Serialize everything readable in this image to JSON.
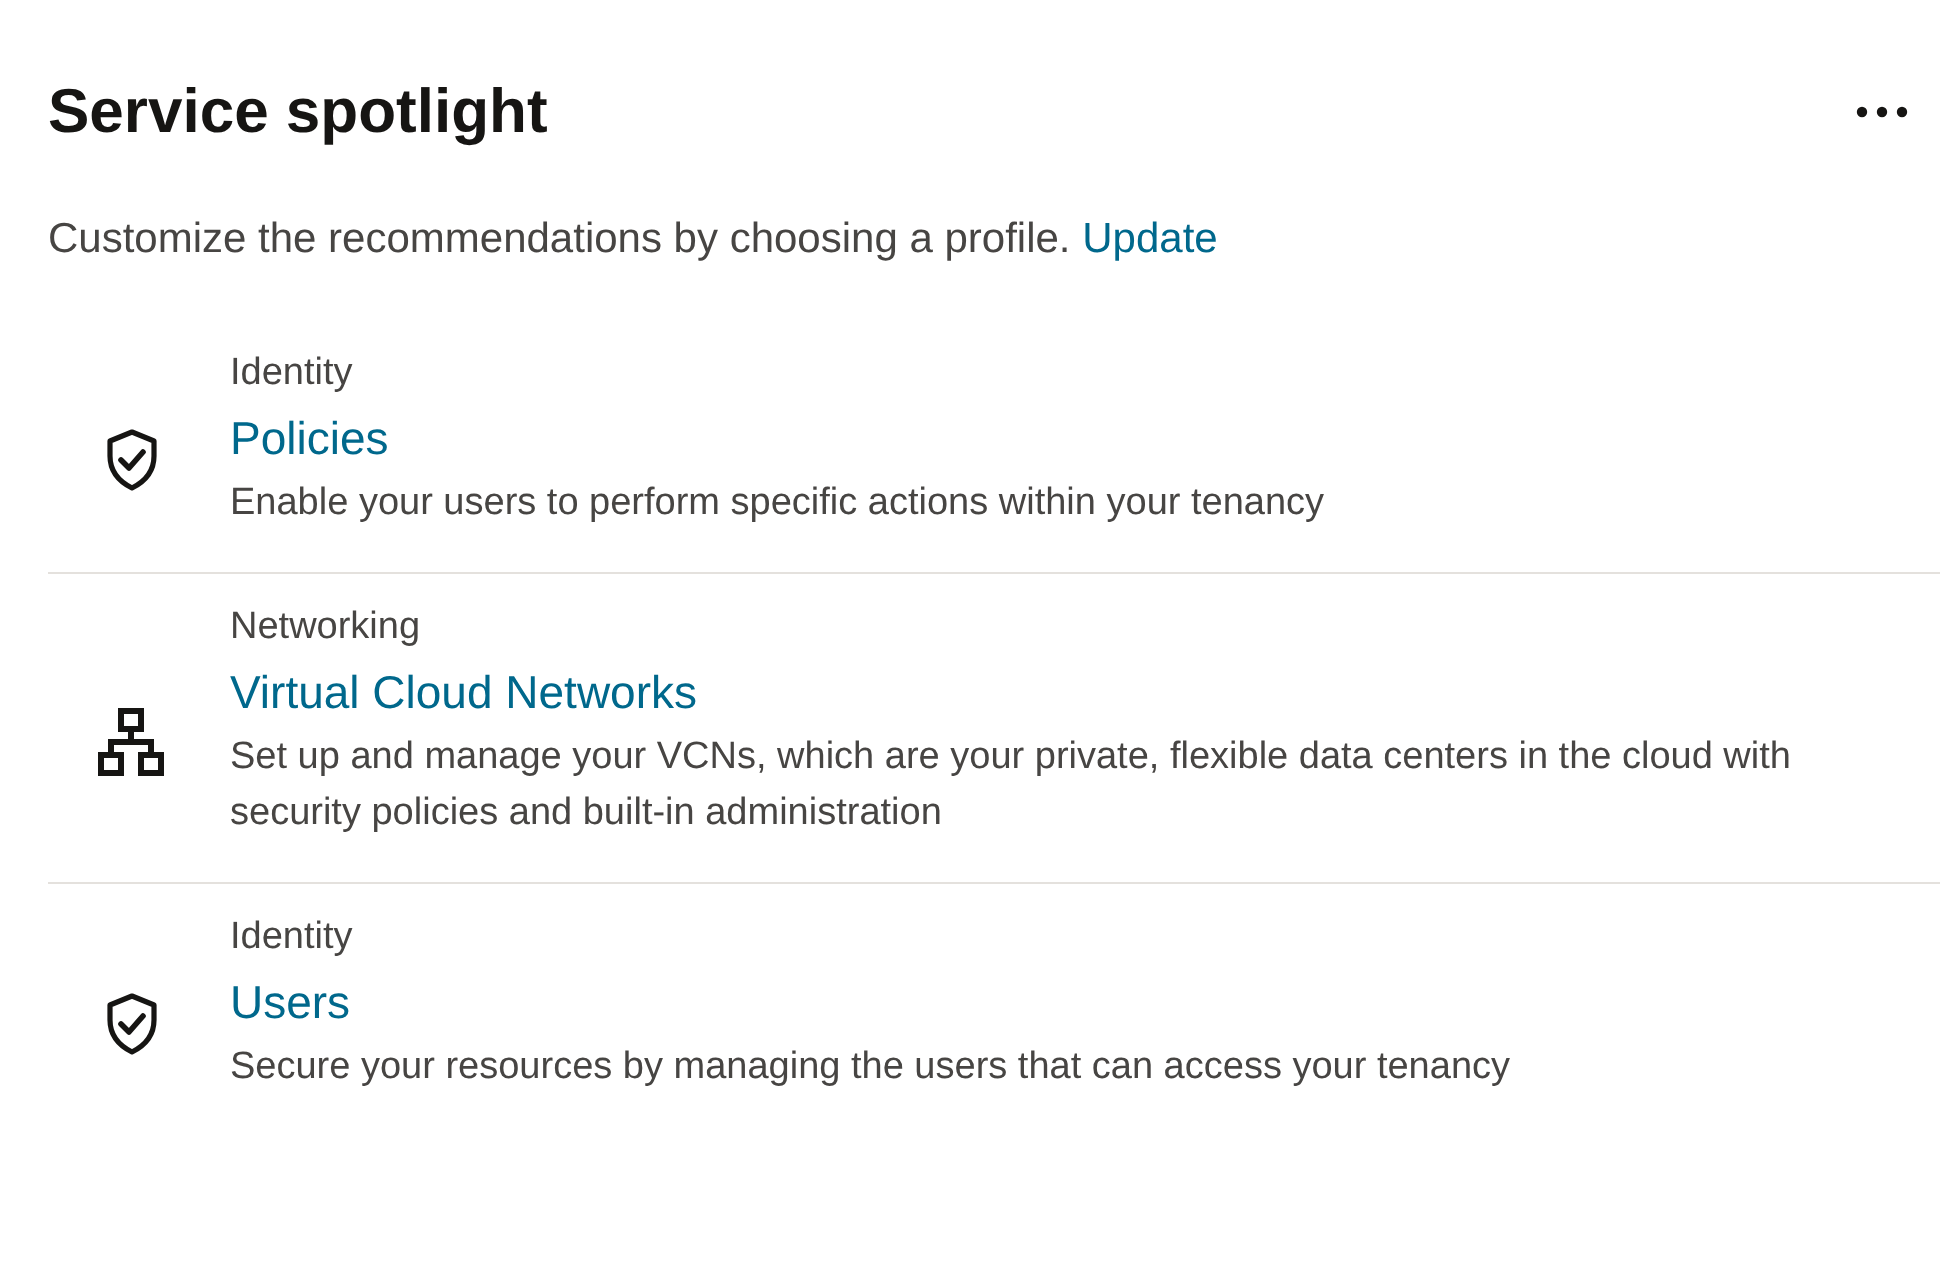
{
  "title": "Service spotlight",
  "subtitle": {
    "text": "Customize the recommendations by choosing a profile.",
    "link": "Update"
  },
  "items": [
    {
      "kind": "shield",
      "category": "Identity",
      "name": "Policies",
      "description": "Enable your users to perform specific actions within your tenancy"
    },
    {
      "kind": "network",
      "category": "Networking",
      "name": "Virtual Cloud Networks",
      "description": "Set up and manage your VCNs, which are your private, flexible data centers in the cloud with security policies and built-in administration"
    },
    {
      "kind": "shield",
      "category": "Identity",
      "name": "Users",
      "description": "Secure your resources by managing the users that can access your tenancy"
    }
  ]
}
